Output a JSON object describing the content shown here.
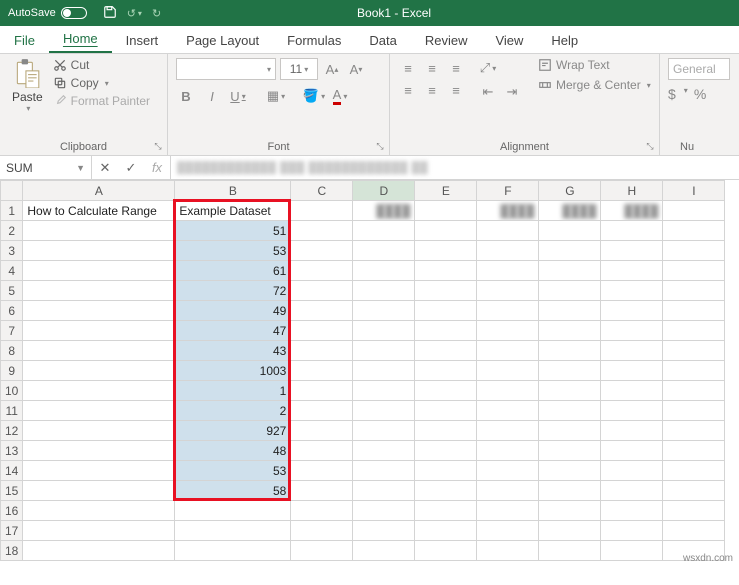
{
  "titlebar": {
    "autosave": "AutoSave",
    "doc_title": "Book1 - Excel"
  },
  "tabs": {
    "file": "File",
    "home": "Home",
    "insert": "Insert",
    "page_layout": "Page Layout",
    "formulas": "Formulas",
    "data": "Data",
    "review": "Review",
    "view": "View",
    "help": "Help"
  },
  "ribbon": {
    "clipboard": {
      "paste": "Paste",
      "cut": "Cut",
      "copy": "Copy",
      "format_painter": "Format Painter",
      "group": "Clipboard"
    },
    "font": {
      "size": "11",
      "b": "B",
      "i": "I",
      "u": "U",
      "group": "Font"
    },
    "alignment": {
      "wrap": "Wrap Text",
      "merge": "Merge & Center",
      "group": "Alignment"
    },
    "number": {
      "format": "General",
      "currency": "$",
      "percent": "%",
      "group": "Nu"
    }
  },
  "name_box": "SUM",
  "fx_label": "fx",
  "columns": [
    "A",
    "B",
    "C",
    "D",
    "E",
    "F",
    "G",
    "H",
    "I"
  ],
  "rows": [
    "1",
    "2",
    "3",
    "4",
    "5",
    "6",
    "7",
    "8",
    "9",
    "10",
    "11",
    "12",
    "13",
    "14",
    "15",
    "16",
    "17",
    "18"
  ],
  "cells": {
    "A1": "How to Calculate Range",
    "B1": "Example Dataset",
    "B2": "51",
    "B3": "53",
    "B4": "61",
    "B5": "72",
    "B6": "49",
    "B7": "47",
    "B8": "43",
    "B9": "1003",
    "B10": "1",
    "B11": "2",
    "B12": "927",
    "B13": "48",
    "B14": "53",
    "B15": "58"
  },
  "selection": {
    "col": "B",
    "rows_from": 2,
    "rows_to": 15
  },
  "red_box": {
    "col": "B",
    "rows_from": 1,
    "rows_to": 15
  },
  "active_cell": "D1",
  "watermark": "wsxdn.com"
}
